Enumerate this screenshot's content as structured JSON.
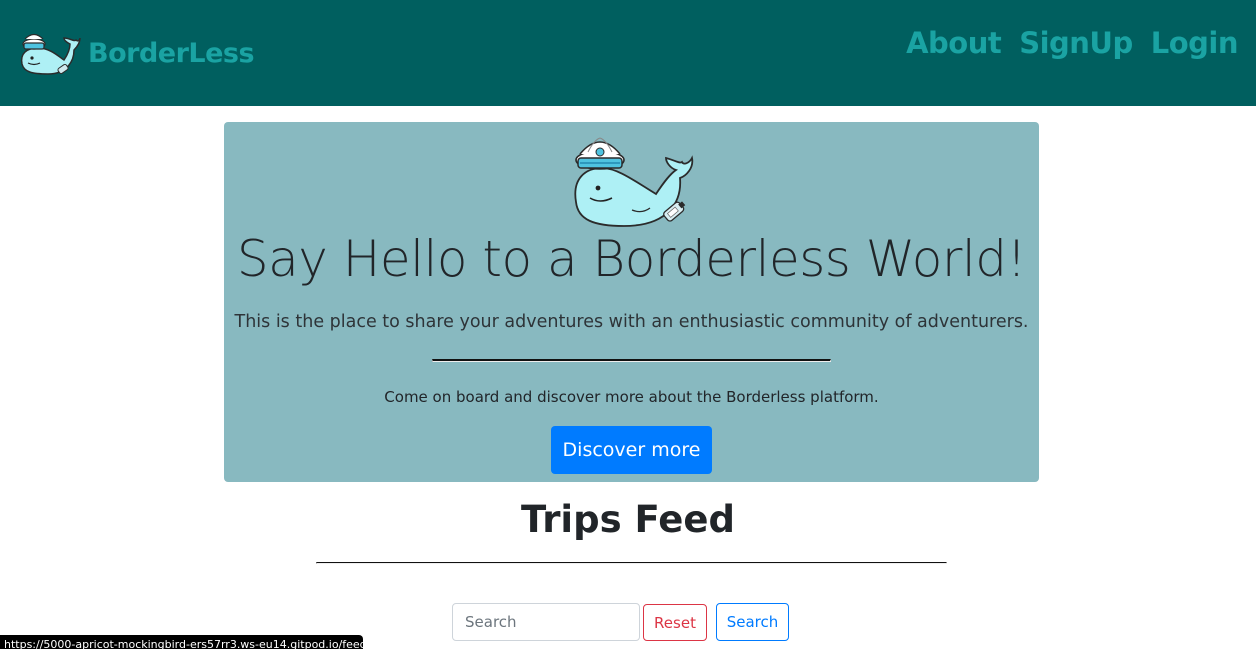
{
  "nav": {
    "brand": "BorderLess",
    "links": [
      {
        "label": "About"
      },
      {
        "label": "SignUp"
      },
      {
        "label": "Login"
      }
    ]
  },
  "hero": {
    "title": "Say Hello to a Borderless World!",
    "lead": "This is the place to share your adventures with an enthusiastic community of adventurers.",
    "text": "Come on board and discover more about the Borderless platform.",
    "button": "Discover more"
  },
  "feed": {
    "title": "Trips Feed",
    "search_placeholder": "Search",
    "search_value": "",
    "reset_label": "Reset",
    "search_label": "Search"
  },
  "status": {
    "url": "https://5000-apricot-mockingbird-ers57rr3.ws-eu14.gitpod.io/feed"
  },
  "colors": {
    "navbar": "#005f5f",
    "brand_text": "#1aa3a3",
    "jumbotron": "#88b9c0",
    "primary": "#007bff",
    "danger": "#dc3545"
  },
  "icons": {
    "logo": "sailor-whale-icon"
  }
}
